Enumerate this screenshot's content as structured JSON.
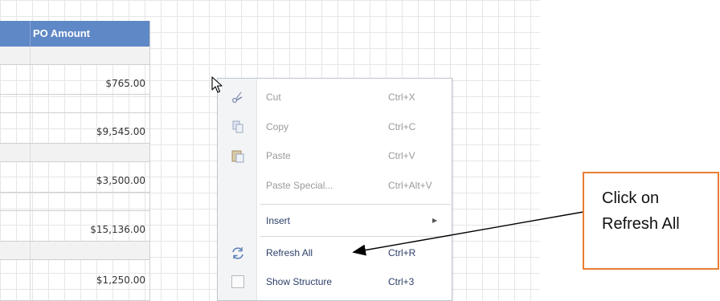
{
  "sheet": {
    "column_header": "PO Amount",
    "values": [
      "$765.00",
      "$9,545.00",
      "$3,500.00",
      "$15,136.00",
      "$1,250.00"
    ]
  },
  "context_menu": {
    "items": [
      {
        "label": "Cut",
        "shortcut": "Ctrl+X",
        "icon": "scissors-icon",
        "enabled": false
      },
      {
        "label": "Copy",
        "shortcut": "Ctrl+C",
        "icon": "copy-icon",
        "enabled": false
      },
      {
        "label": "Paste",
        "shortcut": "Ctrl+V",
        "icon": "paste-icon",
        "enabled": false
      },
      {
        "label": "Paste Special...",
        "shortcut": "Ctrl+Alt+V",
        "icon": "",
        "enabled": false
      },
      {
        "label": "Insert",
        "shortcut": "",
        "icon": "",
        "enabled": true,
        "submenu": true
      },
      {
        "label": "Refresh All",
        "shortcut": "Ctrl+R",
        "icon": "refresh-icon",
        "enabled": true
      },
      {
        "label": "Show Structure",
        "shortcut": "Ctrl+3",
        "icon": "structure-checkbox-icon",
        "enabled": true
      }
    ]
  },
  "callout": {
    "line1": "Click on",
    "line2": "Refresh All"
  },
  "colors": {
    "header_blue": "#5f88c6",
    "callout_border": "#e87e33",
    "menu_text": "#2c3e68"
  }
}
